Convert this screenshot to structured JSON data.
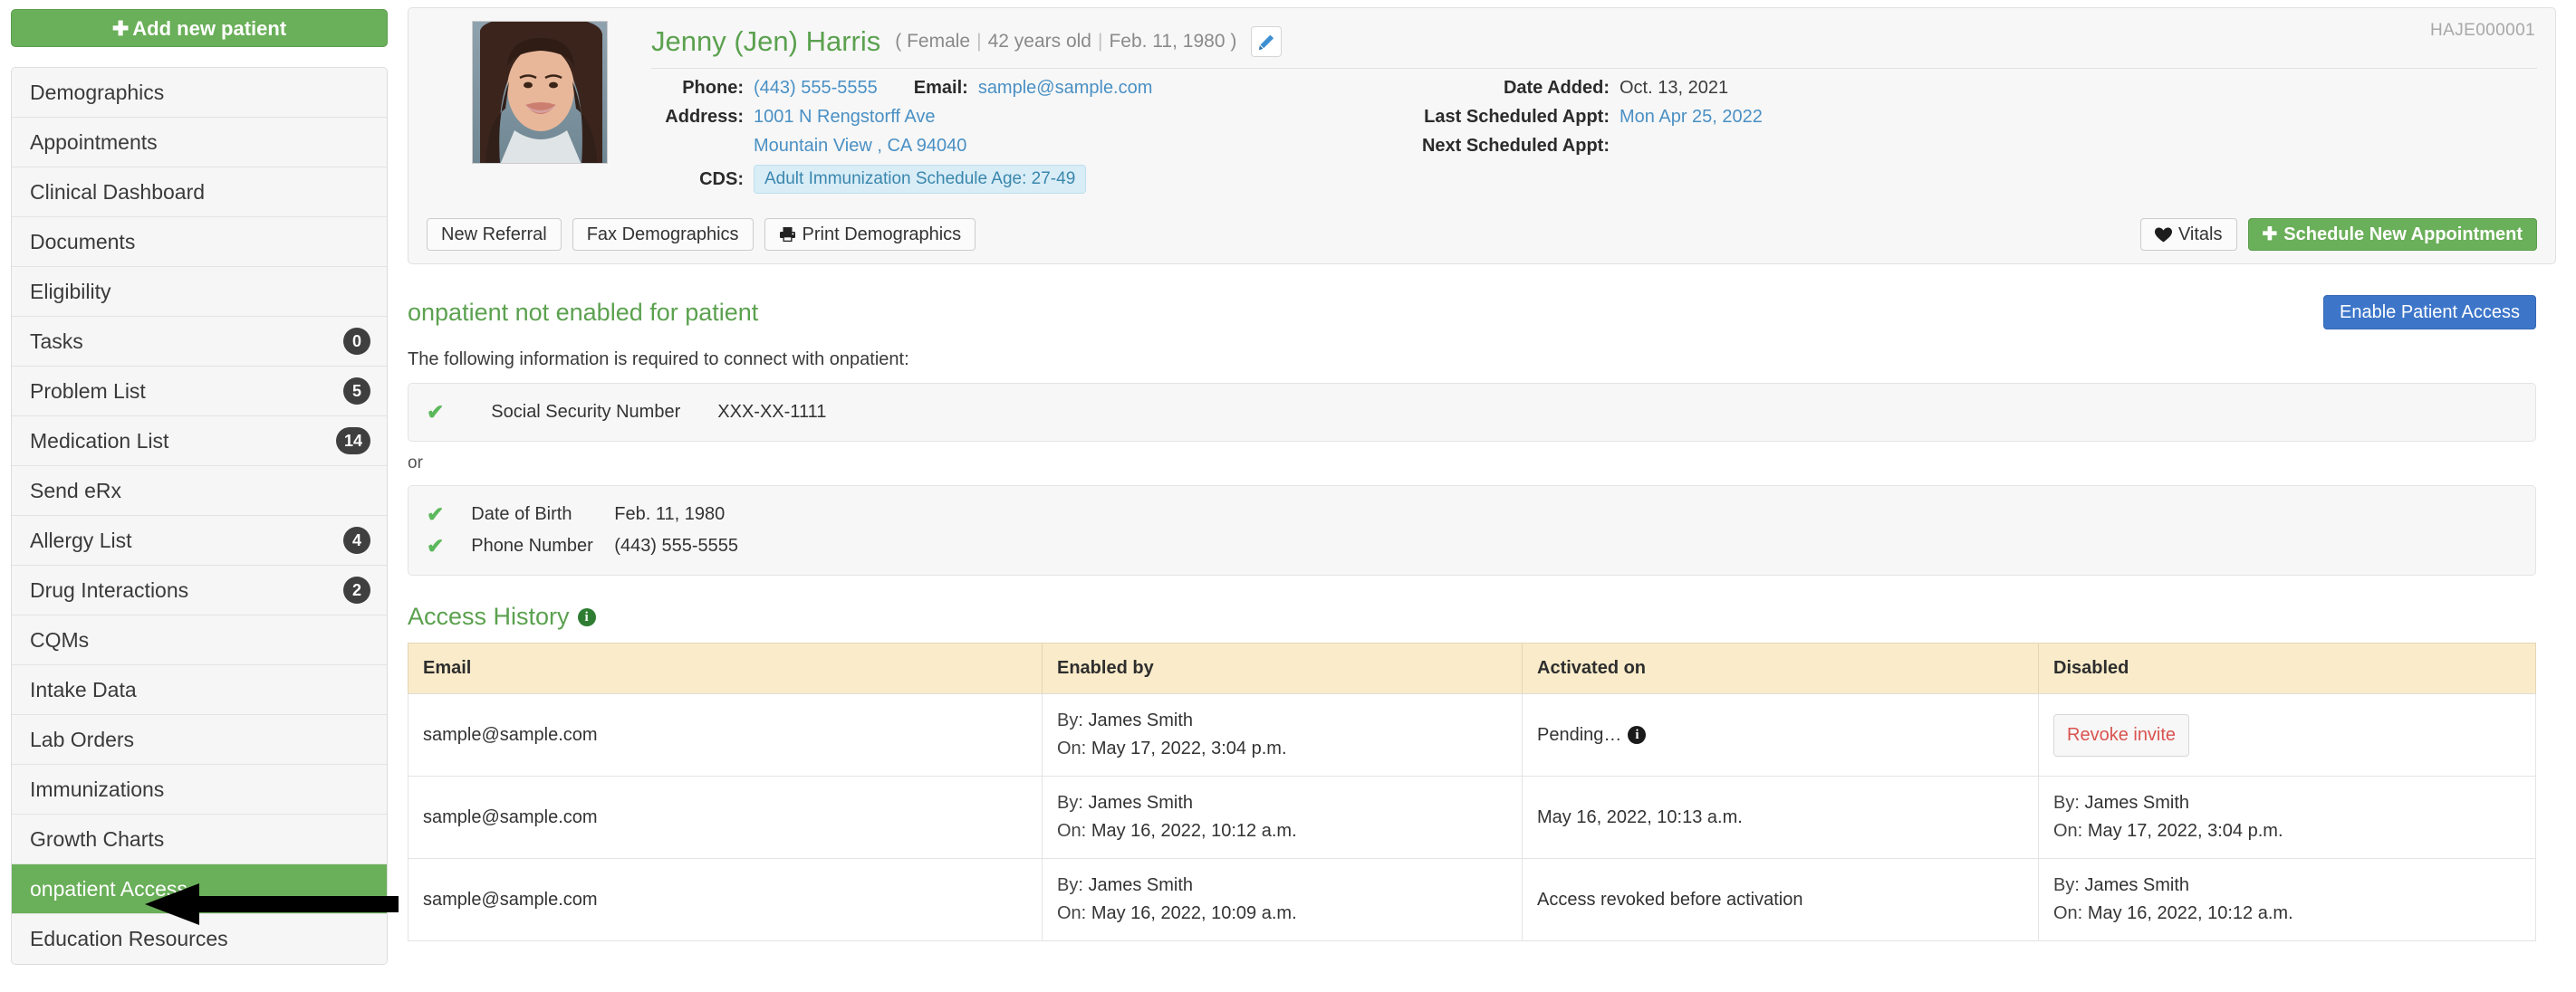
{
  "sidebar": {
    "add_patient_label": "Add new patient",
    "items": [
      {
        "label": "Demographics",
        "badge": null,
        "active": false
      },
      {
        "label": "Appointments",
        "badge": null,
        "active": false
      },
      {
        "label": "Clinical Dashboard",
        "badge": null,
        "active": false
      },
      {
        "label": "Documents",
        "badge": null,
        "active": false
      },
      {
        "label": "Eligibility",
        "badge": null,
        "active": false
      },
      {
        "label": "Tasks",
        "badge": "0",
        "active": false
      },
      {
        "label": "Problem List",
        "badge": "5",
        "active": false
      },
      {
        "label": "Medication List",
        "badge": "14",
        "active": false
      },
      {
        "label": "Send eRx",
        "badge": null,
        "active": false
      },
      {
        "label": "Allergy List",
        "badge": "4",
        "active": false
      },
      {
        "label": "Drug Interactions",
        "badge": "2",
        "active": false
      },
      {
        "label": "CQMs",
        "badge": null,
        "active": false
      },
      {
        "label": "Intake Data",
        "badge": null,
        "active": false
      },
      {
        "label": "Lab Orders",
        "badge": null,
        "active": false
      },
      {
        "label": "Immunizations",
        "badge": null,
        "active": false
      },
      {
        "label": "Growth Charts",
        "badge": null,
        "active": false
      },
      {
        "label": "onpatient Access",
        "badge": null,
        "active": true
      },
      {
        "label": "Education Resources",
        "badge": null,
        "active": false
      }
    ]
  },
  "patient": {
    "name": "Jenny (Jen) Harris",
    "gender": "Female",
    "age": "42 years old",
    "dob": "Feb. 11, 1980",
    "record_id": "HAJE000001",
    "phone_label": "Phone:",
    "phone": "(443) 555-5555",
    "email_label": "Email:",
    "email": "sample@sample.com",
    "address_label": "Address:",
    "address_line1": "1001 N Rengstorff Ave",
    "address_line2": "Mountain View , CA 94040",
    "cds_label": "CDS:",
    "cds_value": "Adult Immunization Schedule Age: 27-49",
    "date_added_label": "Date Added:",
    "date_added": "Oct. 13, 2021",
    "last_appt_label": "Last Scheduled Appt:",
    "last_appt": "Mon Apr 25, 2022",
    "next_appt_label": "Next Scheduled Appt:",
    "next_appt": ""
  },
  "actions": {
    "new_referral": "New Referral",
    "fax_demographics": "Fax Demographics",
    "print_demographics": "Print Demographics",
    "vitals": "Vitals",
    "schedule_appointment": "Schedule New Appointment"
  },
  "onpatient": {
    "title": "onpatient not enabled for patient",
    "enable_button": "Enable Patient Access",
    "subtitle": "The following information is required to connect with onpatient:",
    "requirements_group_1": [
      {
        "name": "Social Security Number",
        "value": "XXX-XX-1111"
      }
    ],
    "or_text": "or",
    "requirements_group_2": [
      {
        "name": "Date of Birth",
        "value": "Feb. 11, 1980"
      },
      {
        "name": "Phone Number",
        "value": "(443) 555-5555"
      }
    ]
  },
  "access_history": {
    "title": "Access History",
    "columns": [
      "Email",
      "Enabled by",
      "Activated on",
      "Disabled"
    ],
    "rows": [
      {
        "email": "sample@sample.com",
        "enabled_by_label": "By:",
        "enabled_by": "James Smith",
        "enabled_on_label": "On:",
        "enabled_on": "May 17, 2022, 3:04 p.m.",
        "activated_on": "Pending…",
        "activated_has_info": true,
        "disabled_type": "button",
        "disabled_button": "Revoke invite",
        "disabled_by_label": "",
        "disabled_by": "",
        "disabled_on_label": "",
        "disabled_on": ""
      },
      {
        "email": "sample@sample.com",
        "enabled_by_label": "By:",
        "enabled_by": "James Smith",
        "enabled_on_label": "On:",
        "enabled_on": "May 16, 2022, 10:12 a.m.",
        "activated_on": "May 16, 2022, 10:13 a.m.",
        "activated_has_info": false,
        "disabled_type": "text",
        "disabled_button": "",
        "disabled_by_label": "By:",
        "disabled_by": "James Smith",
        "disabled_on_label": "On:",
        "disabled_on": "May 17, 2022, 3:04 p.m."
      },
      {
        "email": "sample@sample.com",
        "enabled_by_label": "By:",
        "enabled_by": "James Smith",
        "enabled_on_label": "On:",
        "enabled_on": "May 16, 2022, 10:09 a.m.",
        "activated_on": "Access revoked before activation",
        "activated_has_info": false,
        "disabled_type": "text",
        "disabled_button": "",
        "disabled_by_label": "By:",
        "disabled_by": "James Smith",
        "disabled_on_label": "On:",
        "disabled_on": "May 16, 2022, 10:12 a.m."
      }
    ]
  },
  "colors": {
    "green": "#6aaf59",
    "green_text": "#5ba14f",
    "blue": "#3d76c9",
    "link_blue": "#4a90c4",
    "table_header": "#faecca",
    "revoke_red": "#d9534f"
  }
}
